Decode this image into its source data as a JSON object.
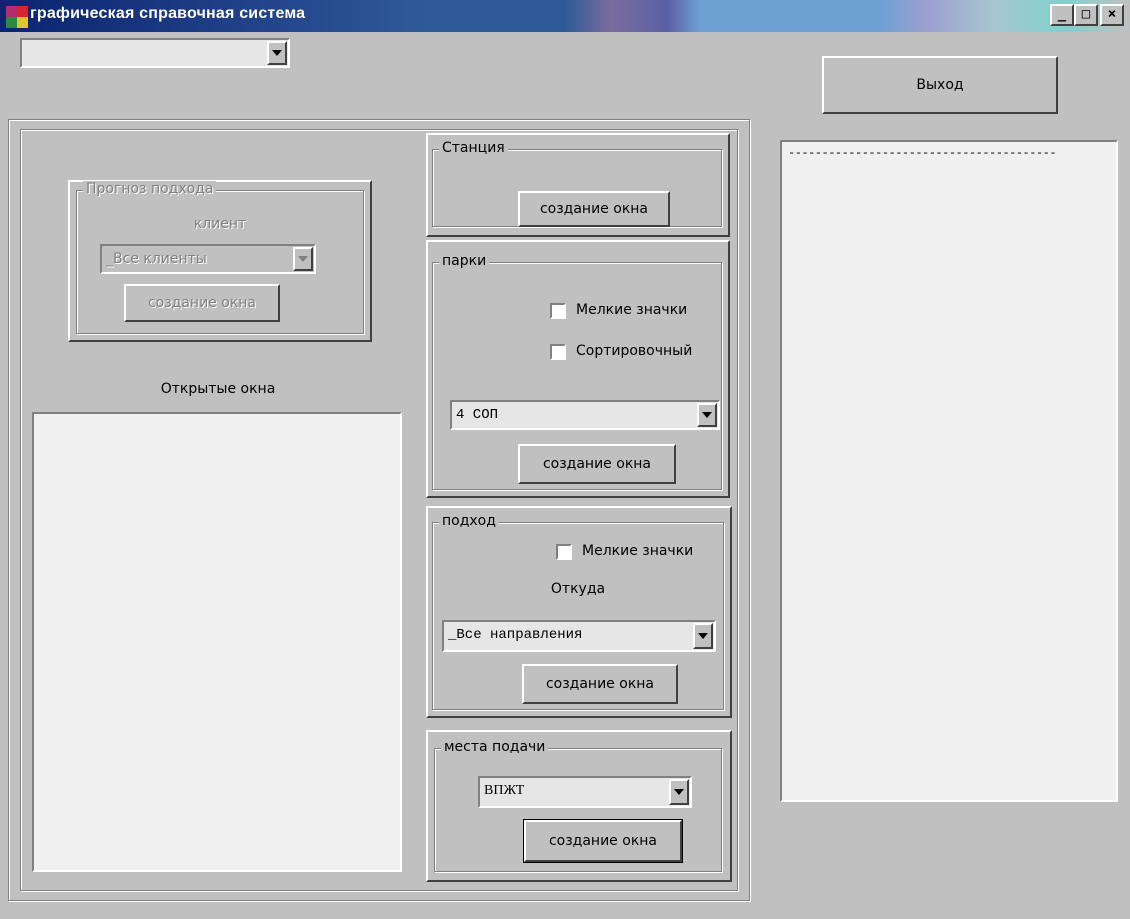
{
  "window": {
    "title": "графическая справочная система"
  },
  "top_combo": {
    "value": ""
  },
  "exit_button": {
    "label": "Выход"
  },
  "forecast": {
    "legend": "Прогноз подхода",
    "client_label": "клиент",
    "client_value": "_Все клиенты",
    "create_label": "создание окна"
  },
  "open_windows": {
    "label": "Открытые окна"
  },
  "station": {
    "legend": "Станция",
    "create_label": "создание окна"
  },
  "parks": {
    "legend": "парки",
    "small_icons": "Мелкие значки",
    "sorting": "Сортировочный",
    "combo_value": "4 СОП",
    "create_label": "создание окна"
  },
  "approach": {
    "legend": "подход",
    "small_icons": "Мелкие значки",
    "from_label": "Откуда",
    "combo_value": "_Все направления",
    "create_label": "создание окна"
  },
  "places": {
    "legend": "места подачи",
    "combo_value": "ВПЖТ",
    "create_label": "создание окна"
  },
  "output": {
    "first_line": "----------------------------------------"
  }
}
